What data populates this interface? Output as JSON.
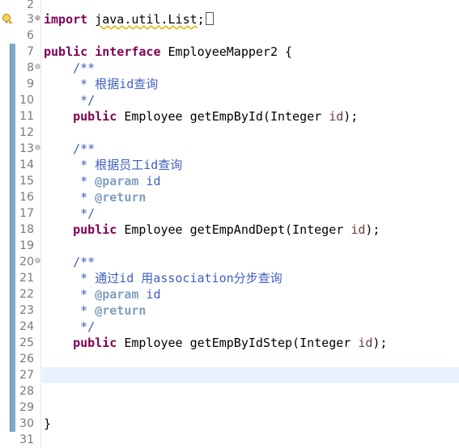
{
  "editor": {
    "lines": [
      {
        "n": "2"
      },
      {
        "n": "3",
        "fold": "⊕",
        "warn": true,
        "kw": "import",
        "rest": "java.util.List",
        "semi": ";"
      },
      {
        "n": "6"
      },
      {
        "n": "7",
        "kw1": "public",
        "kw2": "interface",
        "name": "EmployeeMapper2 {"
      },
      {
        "n": "8",
        "fold": "⊖",
        "text": "    /**"
      },
      {
        "n": "9",
        "text": "     * 根据id查询"
      },
      {
        "n": "10",
        "text": "     */"
      },
      {
        "n": "11",
        "kw": "public",
        "sig": "Employee getEmpById(Integer ",
        "param": "id",
        "end": ");"
      },
      {
        "n": "12"
      },
      {
        "n": "13",
        "fold": "⊖",
        "text": "    /**"
      },
      {
        "n": "14",
        "text": "     * 根据员工id查询"
      },
      {
        "n": "15",
        "star": "     * ",
        "tag": "@param",
        "tagrest": " id"
      },
      {
        "n": "16",
        "star": "     * ",
        "tag": "@return"
      },
      {
        "n": "17",
        "text": "     */"
      },
      {
        "n": "18",
        "kw": "public",
        "sig": "Employee getEmpAndDept(Integer ",
        "param": "id",
        "end": ");"
      },
      {
        "n": "19"
      },
      {
        "n": "20",
        "fold": "⊖",
        "text": "    /**"
      },
      {
        "n": "21",
        "text": "     * 通过id 用association分步查询"
      },
      {
        "n": "22",
        "star": "     * ",
        "tag": "@param",
        "tagrest": " id"
      },
      {
        "n": "23",
        "star": "     * ",
        "tag": "@return"
      },
      {
        "n": "24",
        "text": "     */"
      },
      {
        "n": "25",
        "kw": "public",
        "sig": "Employee getEmpByIdStep(Integer ",
        "param": "id",
        "end": ");"
      },
      {
        "n": "26"
      },
      {
        "n": "27"
      },
      {
        "n": "28"
      },
      {
        "n": "29"
      },
      {
        "n": "30",
        "close": "}"
      },
      {
        "n": "31"
      }
    ]
  }
}
